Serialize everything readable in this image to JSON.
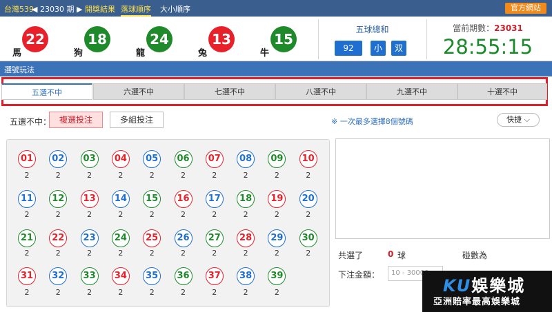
{
  "topbar": {
    "lottery": "台灣539",
    "period_prefix": "◀ 23030 期 ▶",
    "links": [
      "開獎結果",
      "落球順序",
      "大小順序"
    ],
    "official": "官方網站"
  },
  "balls": [
    {
      "number": "22",
      "zodiac": "馬",
      "color": "#e8202a"
    },
    {
      "number": "18",
      "zodiac": "狗",
      "color": "#1e8a2a"
    },
    {
      "number": "24",
      "zodiac": "龍",
      "color": "#1e8a2a"
    },
    {
      "number": "13",
      "zodiac": "兔",
      "color": "#e8202a"
    },
    {
      "number": "15",
      "zodiac": "牛",
      "color": "#1e8a2a"
    }
  ],
  "sum": {
    "title": "五球總和",
    "value": "92",
    "size": "小",
    "parity": "双"
  },
  "current": {
    "label": "當前期數：",
    "period": "23031",
    "countdown": "28:55:15"
  },
  "section_title": "選號玩法",
  "tabs": [
    "五選不中",
    "六選不中",
    "七選不中",
    "八選不中",
    "九選不中",
    "十選不中"
  ],
  "active_tab": 0,
  "mode": {
    "label": "五選不中：",
    "single": "複選投注",
    "multi": "多組投注"
  },
  "hint": "※ 一次最多選擇8個號碼",
  "quick": "快捷 ⌵",
  "numbers": [
    {
      "n": "01",
      "c": "#e8202a"
    },
    {
      "n": "02",
      "c": "#1e6fd0"
    },
    {
      "n": "03",
      "c": "#1e8a2a"
    },
    {
      "n": "04",
      "c": "#e8202a"
    },
    {
      "n": "05",
      "c": "#1e6fd0"
    },
    {
      "n": "06",
      "c": "#1e8a2a"
    },
    {
      "n": "07",
      "c": "#e8202a"
    },
    {
      "n": "08",
      "c": "#1e6fd0"
    },
    {
      "n": "09",
      "c": "#1e8a2a"
    },
    {
      "n": "10",
      "c": "#e8202a"
    },
    {
      "n": "11",
      "c": "#1e6fd0"
    },
    {
      "n": "12",
      "c": "#1e8a2a"
    },
    {
      "n": "13",
      "c": "#e8202a"
    },
    {
      "n": "14",
      "c": "#1e6fd0"
    },
    {
      "n": "15",
      "c": "#1e8a2a"
    },
    {
      "n": "16",
      "c": "#e8202a"
    },
    {
      "n": "17",
      "c": "#1e6fd0"
    },
    {
      "n": "18",
      "c": "#1e8a2a"
    },
    {
      "n": "19",
      "c": "#e8202a"
    },
    {
      "n": "20",
      "c": "#1e6fd0"
    },
    {
      "n": "21",
      "c": "#1e8a2a"
    },
    {
      "n": "22",
      "c": "#e8202a"
    },
    {
      "n": "23",
      "c": "#1e6fd0"
    },
    {
      "n": "24",
      "c": "#1e8a2a"
    },
    {
      "n": "25",
      "c": "#e8202a"
    },
    {
      "n": "26",
      "c": "#1e6fd0"
    },
    {
      "n": "27",
      "c": "#1e8a2a"
    },
    {
      "n": "28",
      "c": "#e8202a"
    },
    {
      "n": "29",
      "c": "#1e6fd0"
    },
    {
      "n": "30",
      "c": "#1e8a2a"
    },
    {
      "n": "31",
      "c": "#e8202a"
    },
    {
      "n": "32",
      "c": "#1e6fd0"
    },
    {
      "n": "33",
      "c": "#1e8a2a"
    },
    {
      "n": "34",
      "c": "#e8202a"
    },
    {
      "n": "35",
      "c": "#1e6fd0"
    },
    {
      "n": "36",
      "c": "#1e8a2a"
    },
    {
      "n": "37",
      "c": "#e8202a"
    },
    {
      "n": "38",
      "c": "#1e6fd0"
    },
    {
      "n": "39",
      "c": "#1e8a2a"
    }
  ],
  "odds_value": "2",
  "summary": {
    "selected_label": "共選了",
    "selected_count": "0",
    "selected_unit": "球",
    "combos_label": "碰數為"
  },
  "amount": {
    "label": "下注金額：",
    "placeholder": "10 - 30000"
  },
  "brand": {
    "ku": "KU",
    "name": "娛樂城",
    "slogan": "亞洲賠率最高娛樂城"
  }
}
